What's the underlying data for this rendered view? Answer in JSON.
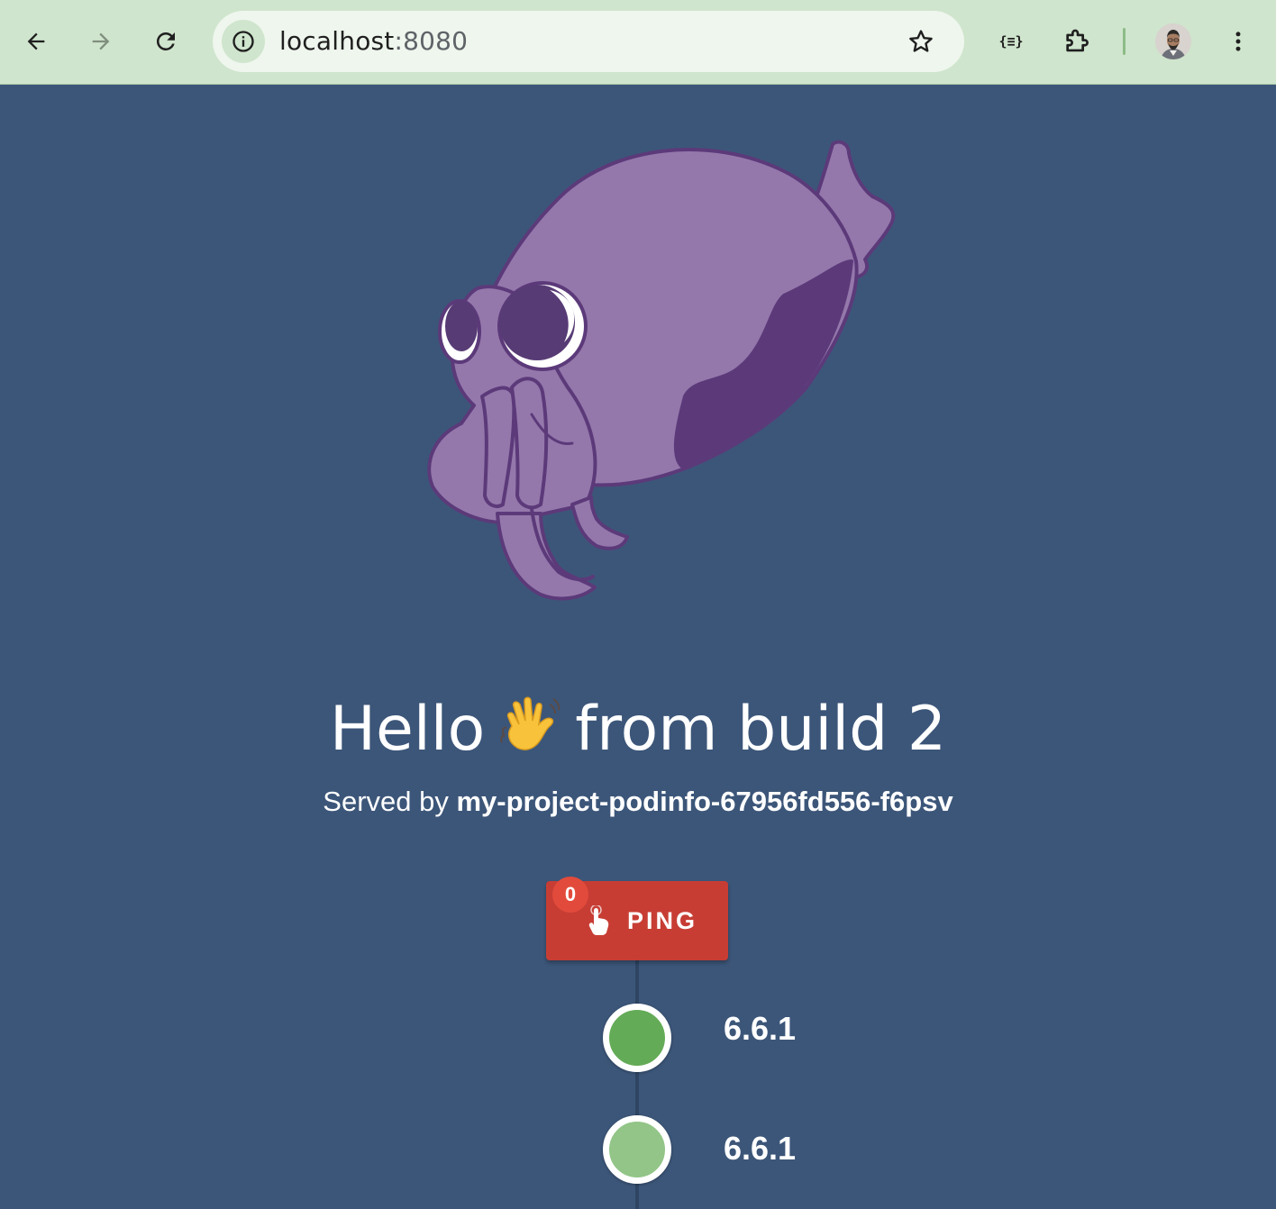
{
  "browser": {
    "url_host": "localhost",
    "url_port": ":8080",
    "extension_label": "{≡}",
    "icons": {
      "back": "arrow-left-icon",
      "forward": "arrow-right-icon",
      "reload": "reload-icon",
      "site_info": "info-icon",
      "bookmark": "star-icon",
      "extensions": "puzzle-icon",
      "menu": "kebab-menu-icon"
    },
    "accent": "#cfe5cd"
  },
  "page": {
    "background": "#3c5679",
    "greeting_before": "Hello",
    "greeting_emoji": "waving-hand-icon",
    "greeting_after": "from build 2",
    "served_prefix": "Served by",
    "served_host": "my-project-podinfo-67956fd556-f6psv",
    "ping": {
      "label": "PING",
      "count": "0",
      "color": "#c73d34"
    },
    "timeline": [
      {
        "version": "6.6.1",
        "color": "#64ab57"
      },
      {
        "version": "6.6.1",
        "color": "#92c587"
      }
    ]
  }
}
